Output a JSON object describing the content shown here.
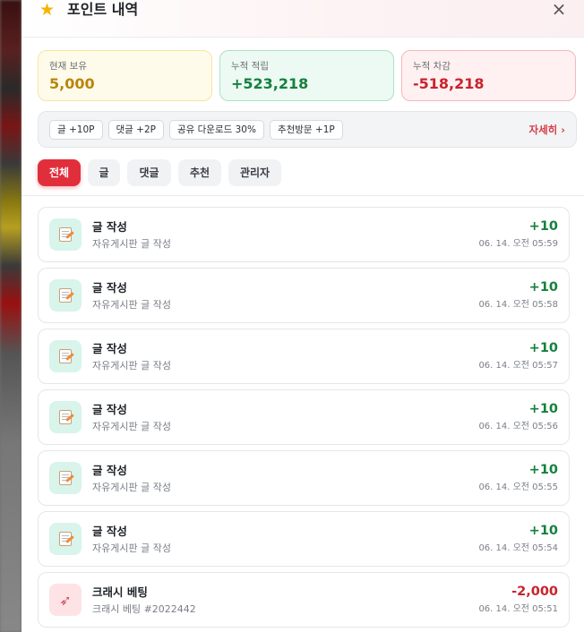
{
  "header": {
    "title": "포인트 내역",
    "star_icon": "star-icon",
    "close_glyph": "×"
  },
  "stats": {
    "hold": {
      "label": "현재 보유",
      "value": "5,000"
    },
    "earned": {
      "label": "누적 적립",
      "value": "+523,218"
    },
    "spent": {
      "label": "누적 차감",
      "value": "-518,218"
    }
  },
  "rules": {
    "chips": [
      "글 +10P",
      "댓글 +2P",
      "공유 다운로드 30%",
      "추천방문 +1P"
    ],
    "more_label": "자세히 ›"
  },
  "tabs": [
    {
      "label": "전체",
      "active": true
    },
    {
      "label": "글",
      "active": false
    },
    {
      "label": "댓글",
      "active": false
    },
    {
      "label": "추천",
      "active": false
    },
    {
      "label": "관리자",
      "active": false
    }
  ],
  "history": [
    {
      "icon": "write-icon",
      "title": "글 작성",
      "desc": "자유게시판 글 작성",
      "amount": "+10",
      "time": "06. 14. 오전 05:59"
    },
    {
      "icon": "write-icon",
      "title": "글 작성",
      "desc": "자유게시판 글 작성",
      "amount": "+10",
      "time": "06. 14. 오전 05:58"
    },
    {
      "icon": "write-icon",
      "title": "글 작성",
      "desc": "자유게시판 글 작성",
      "amount": "+10",
      "time": "06. 14. 오전 05:57"
    },
    {
      "icon": "write-icon",
      "title": "글 작성",
      "desc": "자유게시판 글 작성",
      "amount": "+10",
      "time": "06. 14. 오전 05:56"
    },
    {
      "icon": "write-icon",
      "title": "글 작성",
      "desc": "자유게시판 글 작성",
      "amount": "+10",
      "time": "06. 14. 오전 05:55"
    },
    {
      "icon": "write-icon",
      "title": "글 작성",
      "desc": "자유게시판 글 작성",
      "amount": "+10",
      "time": "06. 14. 오전 05:54"
    },
    {
      "icon": "rocket-icon",
      "title": "크래시 베팅",
      "desc": "크래시 베팅 #2022442",
      "amount": "-2,000",
      "time": "06. 14. 오전 05:51"
    }
  ],
  "colors": {
    "accent": "#e02f3b",
    "plus": "#15803d",
    "minus": "#c8232c",
    "hold": "#b8860b"
  }
}
